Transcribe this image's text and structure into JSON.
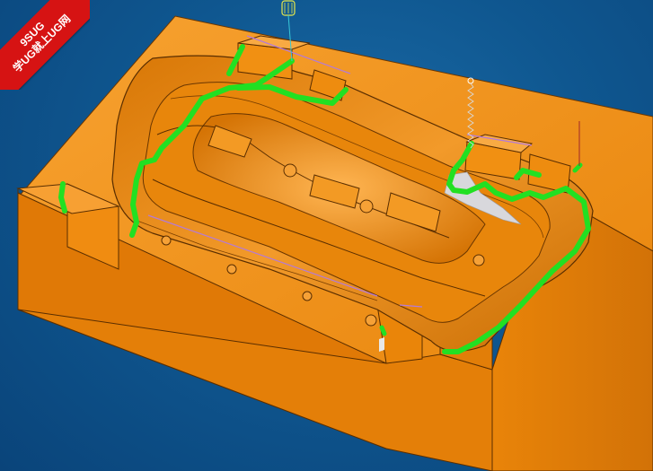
{
  "watermark": {
    "line1": "9SUG",
    "line2": "学UG就上UG网",
    "color": "#d61313"
  },
  "viewport": {
    "background": "#0f5790",
    "description_free": true
  },
  "model": {
    "body_color": "#f08c11",
    "shade_color": "#c86d05",
    "highlight_color": "#fba846",
    "edge_color": "#5a2e00",
    "toolpath_color": "#22e022",
    "tool_color": "#e8e84a",
    "axis_color": "#b07ad8"
  }
}
